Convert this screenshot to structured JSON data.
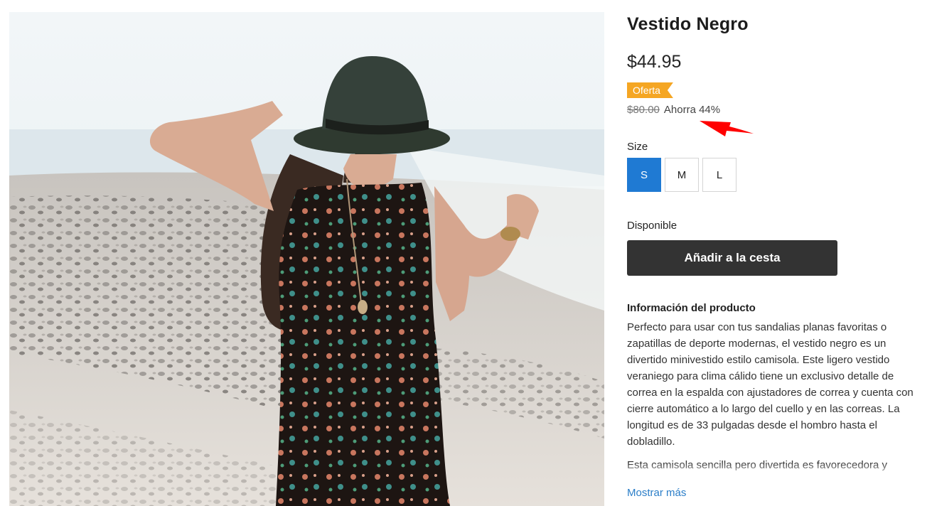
{
  "product": {
    "title": "Vestido Negro",
    "price": "$44.95",
    "sale_badge": "Oferta",
    "compare_price": "$80.00",
    "savings": "Ahorra 44%",
    "size_label": "Size",
    "sizes": [
      "S",
      "M",
      "L"
    ],
    "selected_size": "S",
    "availability": "Disponible",
    "add_to_cart_label": "Añadir a la cesta",
    "info_heading": "Información del producto",
    "description": [
      "Perfecto para usar con tus sandalias planas favoritas o zapatillas de deporte modernas, el vestido negro es un divertido minivestido estilo camisola. Este ligero vestido veraniego para clima cálido tiene un exclusivo detalle de correa en la espalda con ajustadores de correa y cuenta con cierre automático a lo largo del cuello y en las correas. La longitud es de 33 pulgadas desde el hombro hasta el dobladillo.",
      "Esta camisola sencilla pero divertida es favorecedora y divertida. Disponible para su compra a través de"
    ],
    "show_more_label": "Mostrar más"
  },
  "colors": {
    "selected_size": "#1f7ad3",
    "sale_badge": "#f5a623",
    "add_to_cart": "#333333",
    "link": "#2b7ec8",
    "annotation_arrow": "#ff0000"
  },
  "icons": {
    "annotation": "red-arrow-icon"
  }
}
